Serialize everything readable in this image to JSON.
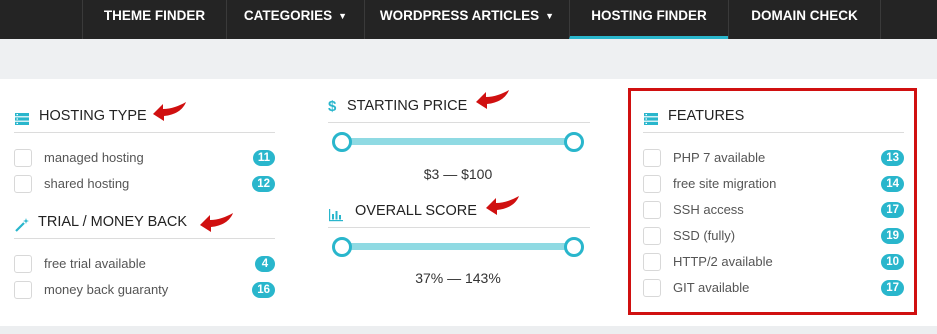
{
  "nav": {
    "items": [
      {
        "label": "THEME FINDER",
        "dropdown": false
      },
      {
        "label": "CATEGORIES",
        "dropdown": true
      },
      {
        "label": "WORDPRESS ARTICLES",
        "dropdown": true
      },
      {
        "label": "HOSTING FINDER",
        "dropdown": false,
        "active": true
      },
      {
        "label": "DOMAIN CHECK",
        "dropdown": false
      }
    ]
  },
  "hosting_type": {
    "title": "HOSTING TYPE",
    "icon": "server-list-icon",
    "options": [
      {
        "label": "managed hosting",
        "count": "11"
      },
      {
        "label": "shared hosting",
        "count": "12"
      }
    ]
  },
  "trial": {
    "title": "TRIAL / MONEY BACK",
    "icon": "magic-wand-icon",
    "options": [
      {
        "label": "free trial available",
        "count": "4"
      },
      {
        "label": "money back guaranty",
        "count": "16"
      }
    ]
  },
  "starting_price": {
    "title": "STARTING PRICE",
    "icon": "dollar-icon",
    "range": "$3 — $100"
  },
  "overall_score": {
    "title": "OVERALL SCORE",
    "icon": "bar-chart-icon",
    "range": "37% — 143%"
  },
  "features": {
    "title": "FEATURES",
    "icon": "server-list-icon",
    "options": [
      {
        "label": "PHP 7 available",
        "count": "13"
      },
      {
        "label": "free site migration",
        "count": "14"
      },
      {
        "label": "SSH access",
        "count": "17"
      },
      {
        "label": "SSD (fully)",
        "count": "19"
      },
      {
        "label": "HTTP/2 available",
        "count": "10"
      },
      {
        "label": "GIT available",
        "count": "17"
      }
    ]
  },
  "colors": {
    "accent": "#29b6cc",
    "nav_bg": "#242424",
    "annotation": "#d01010"
  }
}
